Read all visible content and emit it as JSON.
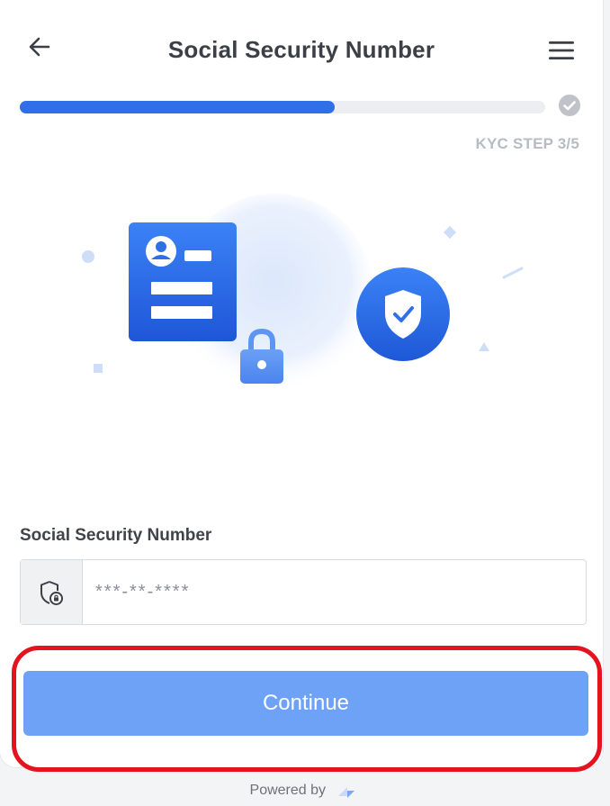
{
  "header": {
    "title": "Social Security Number",
    "back_icon": "arrow-left-icon",
    "menu_icon": "hamburger-menu-icon"
  },
  "progress": {
    "fraction": 0.6,
    "step_label": "KYC STEP 3/5",
    "status_icon": "check-circle-icon"
  },
  "illustration": {
    "icons": [
      "id-card-icon",
      "padlock-icon",
      "shield-check-icon"
    ]
  },
  "form": {
    "ssn_label": "Social Security Number",
    "ssn_placeholder": "***-**-****",
    "ssn_value": "",
    "addon_icon": "shield-lock-icon"
  },
  "actions": {
    "continue_label": "Continue"
  },
  "footer": {
    "powered_by": "Powered by"
  },
  "colors": {
    "primary": "#2f6fe8",
    "button": "#6ea2f6",
    "highlight": "#e3141f"
  }
}
